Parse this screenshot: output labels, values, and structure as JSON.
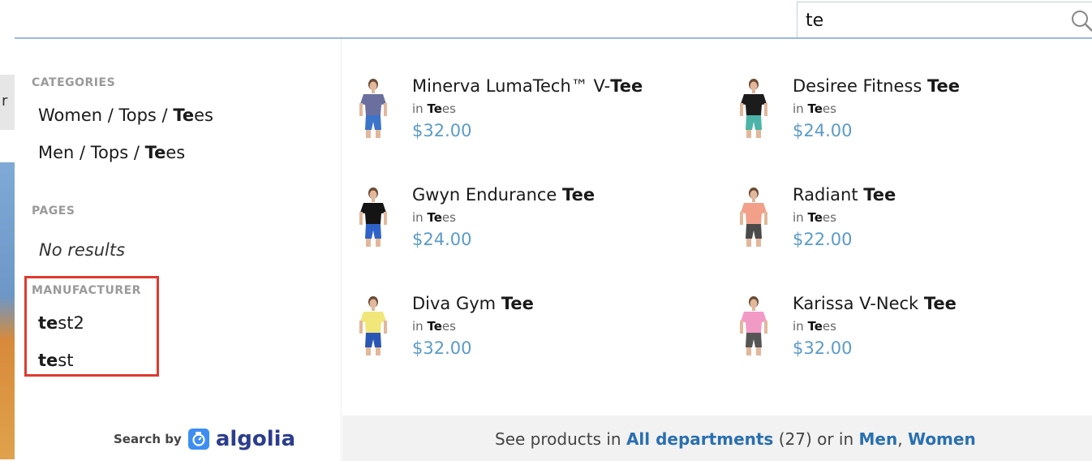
{
  "left_edge": {
    "letter": "r"
  },
  "search": {
    "value": "te"
  },
  "categories": {
    "title": "CATEGORIES",
    "items": [
      {
        "pre": "Women / Tops / ",
        "match": "Te",
        "post": "es"
      },
      {
        "pre": "Men / Tops / ",
        "match": "Te",
        "post": "es"
      }
    ]
  },
  "pages": {
    "title": "PAGES",
    "empty": "No results"
  },
  "manufacturer": {
    "title": "MANUFACTURER",
    "items": [
      {
        "match": "te",
        "post": "st2"
      },
      {
        "match": "te",
        "post": "st"
      }
    ]
  },
  "powered_by": {
    "label": "Search by",
    "brand": "algolia"
  },
  "products": [
    {
      "name_pre": "Minerva LumaTech™ V-",
      "name_match": "Tee",
      "cat_in": "in",
      "cat_match": "Te",
      "cat_post": "es",
      "price": "$32.00",
      "shirt_color": "#6b6fa0",
      "pants_color": "#3b74c9"
    },
    {
      "name_pre": "Desiree Fitness ",
      "name_match": "Tee",
      "cat_in": "in",
      "cat_match": "Te",
      "cat_post": "es",
      "price": "$24.00",
      "shirt_color": "#1c1c1c",
      "pants_color": "#4cb3a8"
    },
    {
      "name_pre": "Gwyn Endurance ",
      "name_match": "Tee",
      "cat_in": "in",
      "cat_match": "Te",
      "cat_post": "es",
      "price": "$24.00",
      "shirt_color": "#141414",
      "pants_color": "#2f62c8"
    },
    {
      "name_pre": "Radiant ",
      "name_match": "Tee",
      "cat_in": "in",
      "cat_match": "Te",
      "cat_post": "es",
      "price": "$22.00",
      "shirt_color": "#f2a08a",
      "pants_color": "#4a4a4a"
    },
    {
      "name_pre": "Diva Gym ",
      "name_match": "Tee",
      "cat_in": "in",
      "cat_match": "Te",
      "cat_post": "es",
      "price": "$32.00",
      "shirt_color": "#f0e67a",
      "pants_color": "#2a57b5"
    },
    {
      "name_pre": "Karissa V-Neck ",
      "name_match": "Tee",
      "cat_in": "in",
      "cat_match": "Te",
      "cat_post": "es",
      "price": "$32.00",
      "shirt_color": "#f29ac6",
      "pants_color": "#555555"
    }
  ],
  "footer": {
    "prefix": "See products in ",
    "all_link": "All departments",
    "count": " (27) or in ",
    "link_men": "Men",
    "sep": ", ",
    "link_women": "Women"
  },
  "colors": {
    "accent": "#5a9bc9",
    "highlight_box": "#dc3b2e",
    "algolia_blue": "#3d8ef2"
  }
}
